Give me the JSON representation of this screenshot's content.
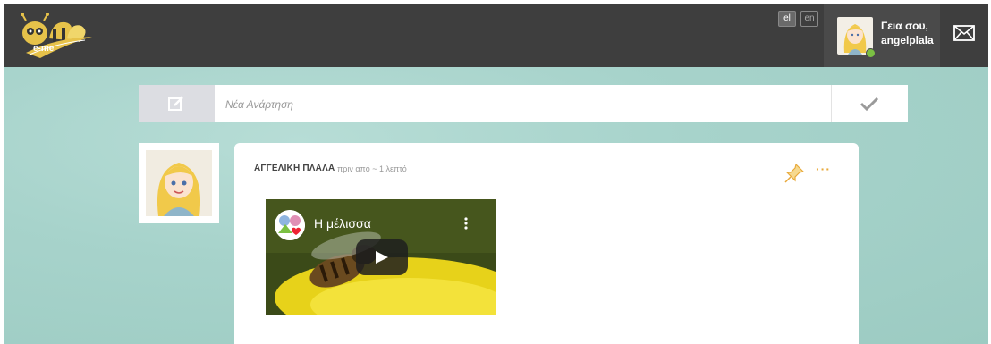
{
  "header": {
    "logo_text": "e-me",
    "languages": [
      "el",
      "en"
    ],
    "active_language": "el",
    "greeting_line1": "Γεια σου,",
    "greeting_line2": "angelplala",
    "mail_icon": "envelope-icon"
  },
  "new_post": {
    "placeholder": "Νέα Ανάρτηση",
    "edit_icon": "edit-icon",
    "submit_icon": "check-icon"
  },
  "post": {
    "author": "ΑΓΓΕΛΙΚΗ ΠΛΑΛΑ",
    "time": "πριν από ~ 1 λεπτό",
    "pin_icon": "pin-icon",
    "more_label": "···",
    "video": {
      "title": "Η μέλισσα",
      "play_icon": "play-icon",
      "menu_icon": "more-vertical-icon"
    }
  },
  "colors": {
    "topbar": "#3e3e3e",
    "background": "#a7d3cb",
    "accent": "#e8a93a",
    "online": "#7bc043"
  }
}
